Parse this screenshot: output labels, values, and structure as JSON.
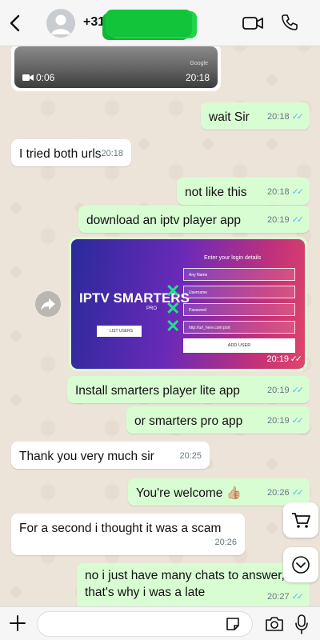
{
  "header": {
    "contact_name": "+31"
  },
  "video_message": {
    "duration": "0:06",
    "time": "20:18",
    "watermark": "Google"
  },
  "messages": [
    {
      "dir": "out",
      "text": "wait Sir",
      "time": "20:18",
      "ticks": "✓✓"
    },
    {
      "dir": "in",
      "text": "I tried both urls",
      "time": "20:18"
    },
    {
      "dir": "out",
      "text": "not like this",
      "time": "20:18",
      "ticks": "✓✓"
    },
    {
      "dir": "out",
      "text": "download an iptv player app",
      "time": "20:19",
      "ticks": "✓✓"
    },
    {
      "dir": "out",
      "text": "Install smarters player lite app",
      "time": "20:19",
      "ticks": "✓✓"
    },
    {
      "dir": "out",
      "text": "or smarters pro app",
      "time": "20:19",
      "ticks": "✓✓"
    },
    {
      "dir": "in",
      "text": "Thank you very much sir",
      "time": "20:25"
    },
    {
      "dir": "out",
      "text": "You're welcome 👍🏼",
      "time": "20:26",
      "ticks": "✓✓"
    },
    {
      "dir": "in",
      "text": "For a second i thought it was a scam",
      "time": "20:26"
    },
    {
      "dir": "out",
      "line1": "no i just have many chats to answer,",
      "line2": "that's why i was a late",
      "time": "20:27",
      "ticks": "✓✓"
    }
  ],
  "image_message": {
    "time": "20:19",
    "ticks": "✓✓",
    "promo": {
      "heading": "Enter your login details",
      "field1": "Any Name",
      "field2": "Username",
      "field3": "Password",
      "field4": "http://url_here.com:port",
      "add_user": "ADD USER",
      "brand": "IPTV SMARTERS",
      "pro": "PRO",
      "list_users": "LIST USERS"
    }
  },
  "composer": {
    "placeholder": ""
  },
  "colors": {
    "outgoing": "#d9fdd3",
    "incoming": "#ffffff",
    "read_ticks": "#53bdeb"
  }
}
